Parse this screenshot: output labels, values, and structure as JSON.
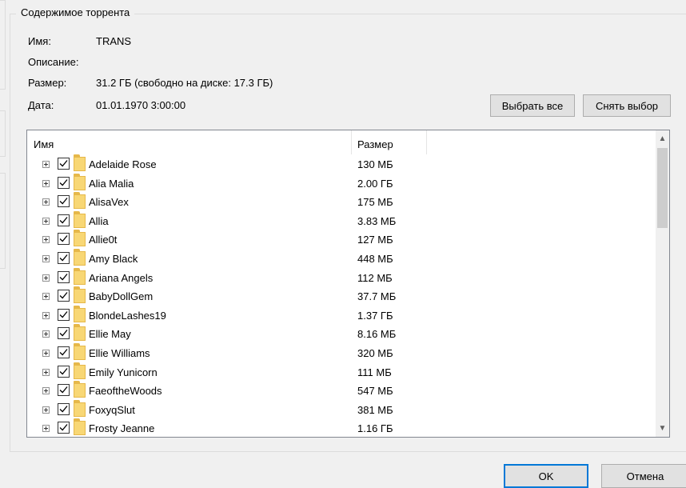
{
  "group_title": "Содержимое торрента",
  "info": {
    "name_label": "Имя:",
    "name_value": "TRANS",
    "description_label": "Описание:",
    "size_label": "Размер:",
    "size_value": "31.2 ГБ (свободно на диске: 17.3 ГБ)",
    "date_label": "Дата:",
    "date_value": "01.01.1970 3:00:00"
  },
  "buttons": {
    "select_all": "Выбрать все",
    "deselect": "Снять выбор",
    "ok": "OK",
    "cancel": "Отмена"
  },
  "tree": {
    "columns": {
      "name": "Имя",
      "size": "Размер"
    },
    "rows": [
      {
        "name": "Adelaide Rose",
        "size": "130 МБ",
        "checked": true
      },
      {
        "name": "Alia Malia",
        "size": "2.00 ГБ",
        "checked": true
      },
      {
        "name": "AlisaVex",
        "size": "175 МБ",
        "checked": true
      },
      {
        "name": "Allia",
        "size": "3.83 МБ",
        "checked": true
      },
      {
        "name": "Allie0t",
        "size": "127 МБ",
        "checked": true
      },
      {
        "name": "Amy Black",
        "size": "448 МБ",
        "checked": true
      },
      {
        "name": "Ariana Angels",
        "size": "112 МБ",
        "checked": true
      },
      {
        "name": "BabyDollGem",
        "size": "37.7 МБ",
        "checked": true
      },
      {
        "name": "BlondeLashes19",
        "size": "1.37 ГБ",
        "checked": true
      },
      {
        "name": "Ellie May",
        "size": "8.16 МБ",
        "checked": true
      },
      {
        "name": "Ellie Williams",
        "size": "320 МБ",
        "checked": true
      },
      {
        "name": "Emily Yunicorn",
        "size": "111 МБ",
        "checked": true
      },
      {
        "name": "FaeoftheWoods",
        "size": "547 МБ",
        "checked": true
      },
      {
        "name": "FoxyqSlut",
        "size": "381 МБ",
        "checked": true
      },
      {
        "name": "Frosty Jeanne",
        "size": "1.16 ГБ",
        "checked": true
      }
    ]
  },
  "icons": {
    "expander": "plus-box-icon",
    "checkbox": "checkmark-icon",
    "folder": "folder-icon",
    "scroll_up": "chevron-up-icon",
    "scroll_down": "chevron-down-icon"
  },
  "colors": {
    "background": "#f0f0f0",
    "folder": "#f8d775",
    "accent": "#0078d7"
  }
}
